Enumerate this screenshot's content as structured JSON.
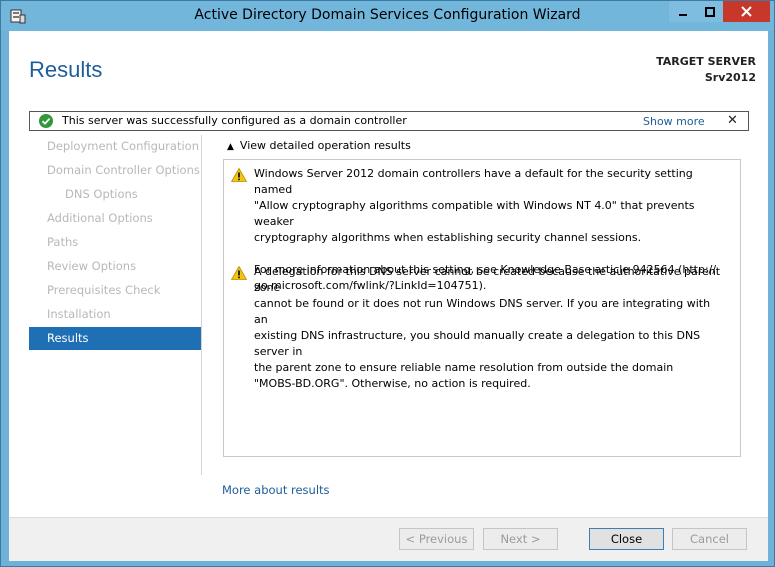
{
  "window": {
    "title": "Active Directory Domain Services Configuration Wizard"
  },
  "header": {
    "page_title": "Results",
    "target_label": "TARGET SERVER",
    "target_name": "Srv2012"
  },
  "notification": {
    "text": "This server was successfully configured as a domain controller",
    "show_more": "Show more",
    "close": "✕"
  },
  "sidebar": {
    "items": [
      {
        "label": "Deployment Configuration",
        "state": "disabled"
      },
      {
        "label": "Domain Controller Options",
        "state": "disabled"
      },
      {
        "label": "DNS Options",
        "state": "disabled"
      },
      {
        "label": "Additional Options",
        "state": "disabled"
      },
      {
        "label": "Paths",
        "state": "disabled"
      },
      {
        "label": "Review Options",
        "state": "disabled"
      },
      {
        "label": "Prerequisites Check",
        "state": "disabled"
      },
      {
        "label": "Installation",
        "state": "disabled"
      },
      {
        "label": "Results",
        "state": "active"
      }
    ]
  },
  "main": {
    "details_toggle": "View detailed operation results",
    "messages": {
      "m1_l1": "Windows Server 2012 domain controllers have a default for the security setting named",
      "m1_l2": "\"Allow cryptography algorithms compatible with Windows NT 4.0\" that prevents weaker",
      "m1_l3": "cryptography algorithms when establishing security channel sessions.",
      "m1_l4": "For more information about this setting, see Knowledge Base article 942564 (http://",
      "m1_l5": "go.microsoft.com/fwlink/?LinkId=104751).",
      "m2_l1": "A delegation for this DNS server cannot be created because the authoritative parent zone",
      "m2_l2": "cannot be found or it does not run Windows DNS server. If you are integrating with an",
      "m2_l3": "existing DNS infrastructure, you should manually create a delegation to this DNS server in",
      "m2_l4": "the parent zone to ensure reliable name resolution from outside the domain",
      "m2_l5": "\"MOBS-BD.ORG\". Otherwise, no action is required."
    },
    "more_about": "More about results"
  },
  "footer": {
    "previous": "< Previous",
    "next": "Next >",
    "close": "Close",
    "cancel": "Cancel"
  },
  "colors": {
    "accent": "#1e6fb4",
    "link": "#1e5d9c",
    "window_frame": "#6fb2d8",
    "close_button": "#c7382a"
  }
}
